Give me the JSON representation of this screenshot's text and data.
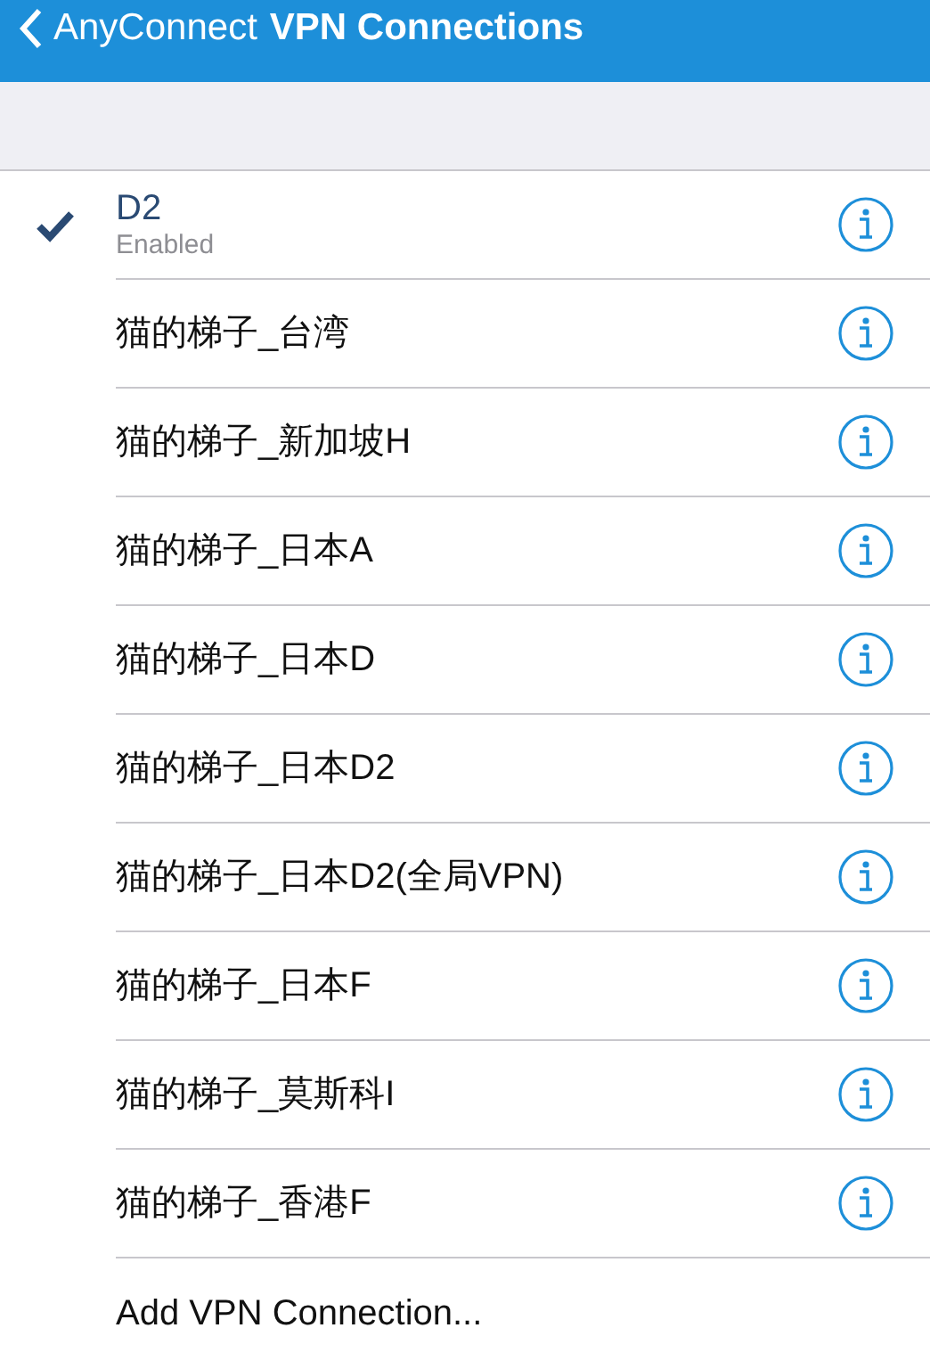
{
  "header": {
    "back_label": "AnyConnect",
    "title": "VPN Connections"
  },
  "connections": [
    {
      "name": "D2",
      "status": "Enabled",
      "selected": true
    },
    {
      "name": "猫的梯子_台湾",
      "selected": false
    },
    {
      "name": "猫的梯子_新加坡H",
      "selected": false
    },
    {
      "name": "猫的梯子_日本A",
      "selected": false
    },
    {
      "name": "猫的梯子_日本D",
      "selected": false
    },
    {
      "name": "猫的梯子_日本D2",
      "selected": false
    },
    {
      "name": "猫的梯子_日本D2(全局VPN)",
      "selected": false
    },
    {
      "name": "猫的梯子_日本F",
      "selected": false
    },
    {
      "name": "猫的梯子_莫斯科I",
      "selected": false
    },
    {
      "name": "猫的梯子_香港F",
      "selected": false
    }
  ],
  "add_label": "Add VPN Connection..."
}
